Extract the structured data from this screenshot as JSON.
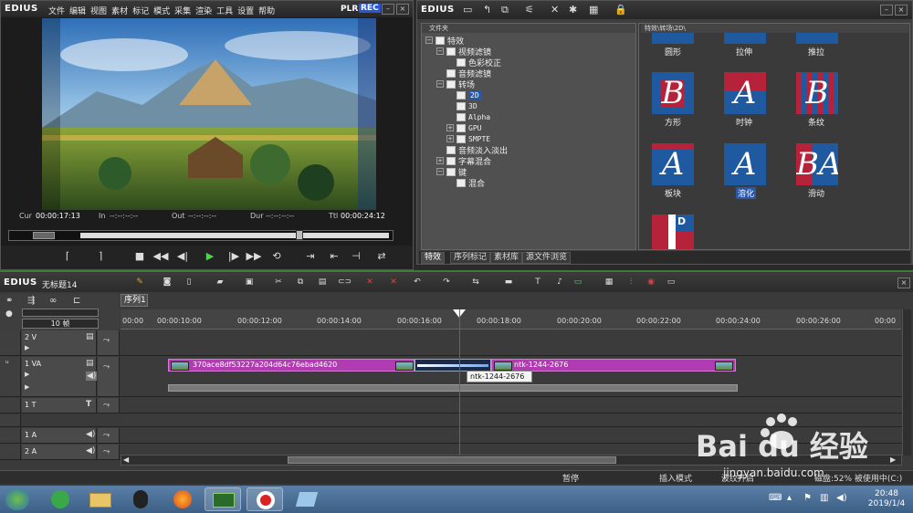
{
  "player": {
    "brand": "EDIUS",
    "menu": [
      "文件",
      "编辑",
      "视图",
      "素材",
      "标记",
      "模式",
      "采集",
      "渲染",
      "工具",
      "设置",
      "帮助"
    ],
    "plr": "PLR",
    "rec": "REC",
    "timecodes": {
      "cur_label": "Cur",
      "cur": "00:00:17:13",
      "in_label": "In",
      "in": "--:--:--:--",
      "out_label": "Out",
      "out": "--:--:--:--",
      "dur_label": "Dur",
      "dur": "--:--:--:--",
      "ttl_label": "Ttl",
      "ttl": "00:00:24:12"
    }
  },
  "palette": {
    "brand": "EDIUS",
    "tree_header": "文件夹",
    "tree": {
      "root": "特效",
      "video_filters": "视频滤镜",
      "color_correction": "色彩校正",
      "audio_filters": "音频滤镜",
      "transitions": "转场",
      "t2d": "2D",
      "t3d": "3D",
      "alpha": "Alpha",
      "gpu": "GPU",
      "smpte": "SMPTE",
      "audio_fade": "音频淡入淡出",
      "title_mix": "字幕混合",
      "keyer": "键",
      "blend": "混合"
    },
    "path": "特效\\转场\\2D\\",
    "items": [
      {
        "label": "圆形",
        "glyph": ""
      },
      {
        "label": "拉伸",
        "glyph": ""
      },
      {
        "label": "推拉",
        "glyph": ""
      },
      {
        "label": "方形",
        "glyph": "B"
      },
      {
        "label": "时钟",
        "glyph": "A"
      },
      {
        "label": "条纹",
        "glyph": "B"
      },
      {
        "label": "板块",
        "glyph": "A"
      },
      {
        "label": "溶化",
        "glyph": "A"
      },
      {
        "label": "滑动",
        "glyph": "BA"
      },
      {
        "label": "",
        "glyph": "D"
      }
    ],
    "tabs": [
      "特效",
      "序列标记",
      "素材库",
      "源文件浏览"
    ]
  },
  "timeline": {
    "brand": "EDIUS",
    "project": "无标题14",
    "zoom": "10 帧",
    "sequence_tab": "序列1",
    "ruler": [
      "00:00:10:00",
      "00:00:12:00",
      "00:00:14:00",
      "00:00:16:00",
      "00:00:18:00",
      "00:00:20:00",
      "00:00:22:00",
      "00:00:24:00",
      "00:00:26:00"
    ],
    "ruler_head": "00:00",
    "ruler_tail": "00:00",
    "tracks": {
      "v2": "2 V",
      "va1": "1 VA",
      "t1": "1 T",
      "a1": "1 A",
      "a2": "2 A"
    },
    "clip1": "370ace8df53227a204d64c76ebad4620",
    "clip2": "ntk-1244-2676",
    "tooltip": "ntk-1244-2676",
    "status": {
      "paused": "暂停",
      "insert": "插入模式",
      "ripple": "波纹开启",
      "disk": "磁盘:52% 被使用中(C:)"
    }
  },
  "taskbar": {
    "time": "20:48",
    "date": "2019/1/4"
  },
  "watermark": {
    "text": "Bai du 经验",
    "url": "jingyan.baidu.com"
  },
  "colors": {
    "accent_green": "#3c7a3c",
    "clip_magenta": "#b13cb1",
    "selection_blue": "#2a57a8",
    "rec_blue": "#2a57d8"
  }
}
